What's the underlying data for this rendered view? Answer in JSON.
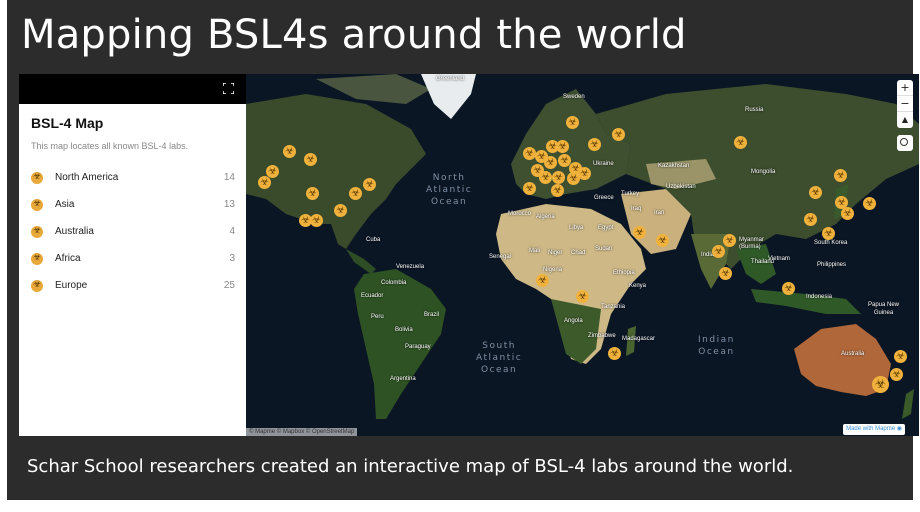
{
  "slide": {
    "title": "Mapping BSL4s around the world",
    "caption": "Schar School researchers created an interactive map of BSL-4 labs around the world."
  },
  "sidebar": {
    "title": "BSL-4 Map",
    "description": "This map locates all known BSL-4 labs.",
    "regions": [
      {
        "name": "North America",
        "count": "14"
      },
      {
        "name": "Asia",
        "count": "13"
      },
      {
        "name": "Australia",
        "count": "4"
      },
      {
        "name": "Africa",
        "count": "3"
      },
      {
        "name": "Europe",
        "count": "25"
      }
    ],
    "icons": {
      "region": "biohazard-icon",
      "fullscreen": "fullscreen-icon",
      "collapse": "chevron-left-icon"
    }
  },
  "map": {
    "controls": {
      "zoom_in": "+",
      "zoom_out": "−",
      "compass": "▲",
      "locate_icon": "locate-icon"
    },
    "oceans": {
      "north_atlantic": [
        "North",
        "Atlantic",
        "Ocean"
      ],
      "south_atlantic": [
        "South",
        "Atlantic",
        "Ocean"
      ],
      "indian": [
        "Indian",
        "Ocean"
      ]
    },
    "labels": {
      "greenland": "Greenland",
      "sweden": "Sweden",
      "russia": "Russia",
      "ukraine": "Ukraine",
      "kazakhstan": "Kazakhstan",
      "mongolia": "Mongolia",
      "uzbekistan": "Uzbekistan",
      "turkey": "Turkey",
      "greece": "Greece",
      "iran": "Iran",
      "iraq": "Iraq",
      "morocco": "Morocco",
      "algeria": "Algeria",
      "libya": "Libya",
      "egypt": "Egypt",
      "mali": "Mali",
      "niger": "Niger",
      "chad": "Chad",
      "sudan": "Sudan",
      "senegal": "Senegal",
      "nigeria": "Nigeria",
      "ethiopia": "Ethiopia",
      "kenya": "Kenya",
      "tanzania": "Tanzania",
      "angola": "Angola",
      "zimbabwe": "Zimbabwe",
      "madagascar": "Madagascar",
      "myanmar": "Myanmar\n(Burma)",
      "thailand": "Thailand",
      "vietnam": "Vietnam",
      "philippines": "Philippines",
      "indonesia": "Indonesia",
      "png": "Papua New\nGuinea",
      "australia": "Australia",
      "cuba": "Cuba",
      "venezuela": "Venezuela",
      "colombia": "Colombia",
      "ecuador": "Ecuador",
      "peru": "Peru",
      "brazil": "Brazil",
      "bolivia": "Bolivia",
      "paraguay": "Paraguay",
      "argentina": "Argentina",
      "india": "India",
      "south_korea": "South Korea"
    },
    "attribution": "© Mapme © Mapbox © OpenStreetMap",
    "badge": "Made with Mapme ◉"
  },
  "colors": {
    "marker": "#f0b23c",
    "background": "#2c2c2c",
    "accent": "#3a8fd8"
  }
}
